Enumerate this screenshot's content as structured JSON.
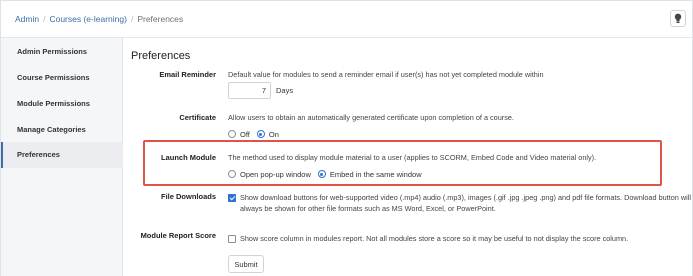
{
  "breadcrumb": {
    "items": [
      "Admin",
      "Courses (e-learning)"
    ],
    "separator": "/",
    "current": "Preferences"
  },
  "help_icon": "lightbulb-icon",
  "sidebar": {
    "items": [
      {
        "label": "Admin Permissions",
        "active": false
      },
      {
        "label": "Course Permissions",
        "active": false
      },
      {
        "label": "Module Permissions",
        "active": false
      },
      {
        "label": "Manage Categories",
        "active": false
      },
      {
        "label": "Preferences",
        "active": true
      }
    ]
  },
  "main": {
    "title": "Preferences",
    "email_reminder": {
      "label": "Email Reminder",
      "description": "Default value for modules to send a reminder email if user(s) has not yet completed module within",
      "value": "7",
      "unit": "Days"
    },
    "certificate": {
      "label": "Certificate",
      "description": "Allow users to obtain an automatically generated certificate upon completion of a course.",
      "options": [
        "Off",
        "On"
      ],
      "selected": "On"
    },
    "launch_module": {
      "label": "Launch Module",
      "description": "The method used to display module material to a user (applies to SCORM, Embed Code and Video material only).",
      "options": [
        "Open pop-up window",
        "Embed in the same window"
      ],
      "selected": "Embed in the same window"
    },
    "file_downloads": {
      "label": "File Downloads",
      "checked": true,
      "description": "Show download buttons for web-supported video (.mp4) audio (.mp3), images (.gif .jpg .jpeg .png) and pdf file formats. Download button will always be shown for other file formats such as MS Word, Excel, or PowerPoint."
    },
    "module_report_score": {
      "label": "Module Report Score",
      "checked": false,
      "description": "Show score column in modules report. Not all modules store a score so it may be useful to not display the score column."
    },
    "submit_label": "Submit"
  },
  "colors": {
    "link": "#3a6ea5",
    "accent": "#2f72d6",
    "highlight_border": "#e0534a",
    "sidebar_bg": "#f5f6f7"
  }
}
